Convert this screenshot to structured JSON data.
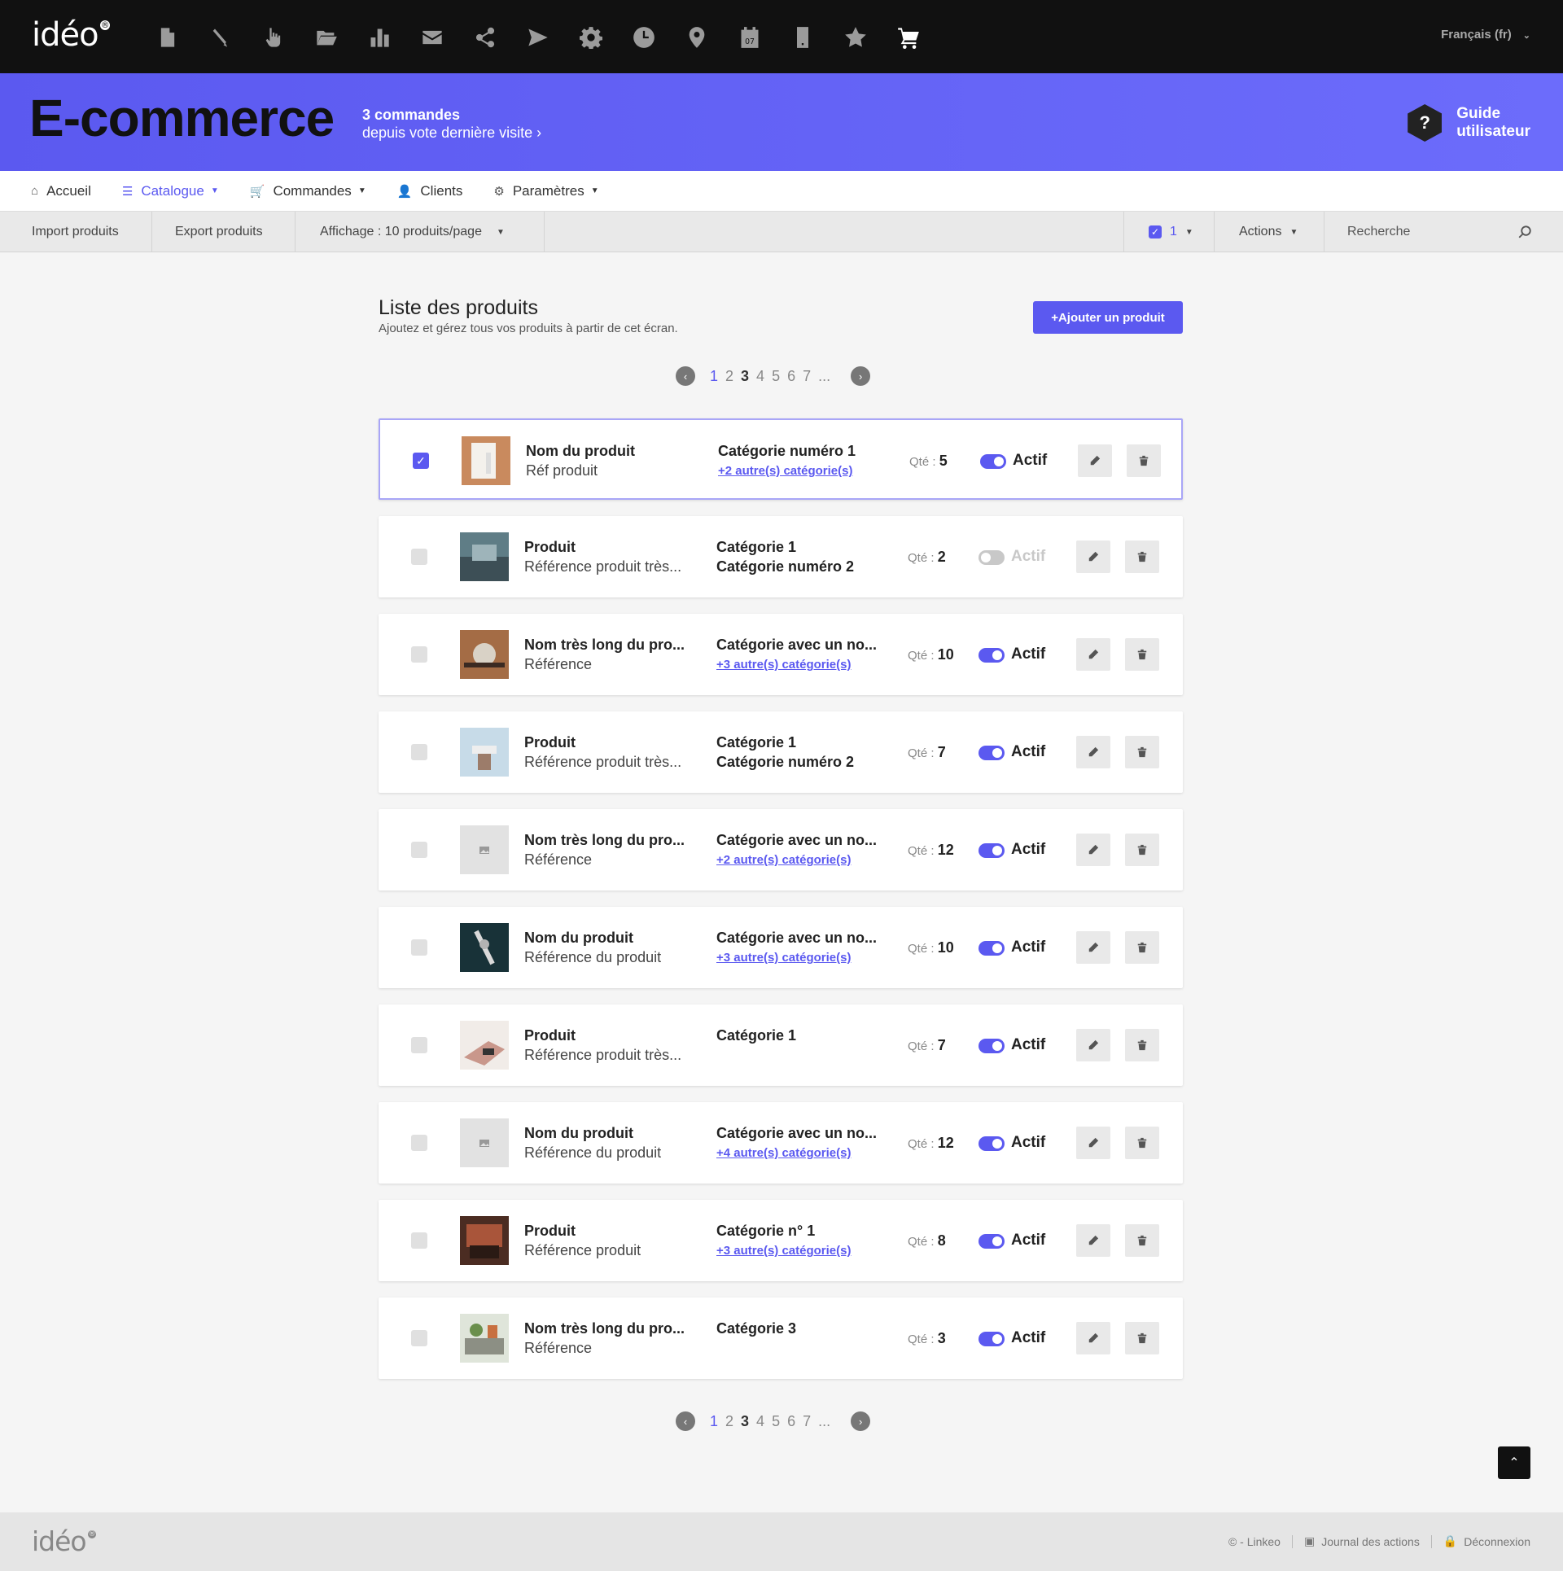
{
  "logo": "idéo",
  "topbar": {
    "icons": [
      "document-icon",
      "pencil-icon",
      "hand-pointer-icon",
      "folder-icon",
      "bar-chart-icon",
      "envelope-icon",
      "share-icon",
      "send-icon",
      "gear-icon",
      "clock-icon",
      "map-pin-icon",
      "calendar-icon",
      "mobile-icon",
      "star-icon",
      "cart-icon"
    ],
    "calendar_day": "07",
    "language": "Français (fr)"
  },
  "banner": {
    "title": "E-commerce",
    "orders_count": "3 commandes",
    "orders_since": "depuis vote dernière visite",
    "guide_icon": "?",
    "guide_line1": "Guide",
    "guide_line2": "utilisateur"
  },
  "nav": {
    "home": "Accueil",
    "catalogue": "Catalogue",
    "orders": "Commandes",
    "clients": "Clients",
    "settings": "Paramètres"
  },
  "toolbar": {
    "import": "Import produits",
    "export": "Export produits",
    "display": "Affichage : 10 produits/page",
    "selected_count": "1",
    "actions": "Actions",
    "search_placeholder": "Recherche"
  },
  "list": {
    "title": "Liste des produits",
    "subtitle": "Ajoutez et gérez tous vos produits à partir de cet écran.",
    "add_button": "+Ajouter un produit",
    "qty_label": "Qté :"
  },
  "pagination": {
    "pages": [
      "1",
      "2",
      "3",
      "4",
      "5",
      "6",
      "7",
      "..."
    ],
    "current": "1"
  },
  "products": [
    {
      "name": "Nom du produit",
      "ref": "Réf produit",
      "cat1": "Catégorie numéro 1",
      "cat2": "",
      "more": "+2 autre(s) catégorie(s)",
      "qty": "5",
      "status": "Actif",
      "active": true,
      "selected": true
    },
    {
      "name": "Produit",
      "ref": "Référence produit très...",
      "cat1": "Catégorie 1",
      "cat2": "Catégorie numéro 2",
      "more": "",
      "qty": "2",
      "status": "Actif",
      "active": false,
      "selected": false
    },
    {
      "name": "Nom très long du pro...",
      "ref": "Référence",
      "cat1": "Catégorie avec un no...",
      "cat2": "",
      "more": "+3 autre(s) catégorie(s)",
      "qty": "10",
      "status": "Actif",
      "active": true,
      "selected": false
    },
    {
      "name": "Produit",
      "ref": "Référence produit très...",
      "cat1": "Catégorie 1",
      "cat2": "Catégorie numéro 2",
      "more": "",
      "qty": "7",
      "status": "Actif",
      "active": true,
      "selected": false
    },
    {
      "name": "Nom très long du pro...",
      "ref": "Référence",
      "cat1": "Catégorie avec un no...",
      "cat2": "",
      "more": "+2 autre(s) catégorie(s)",
      "qty": "12",
      "status": "Actif",
      "active": true,
      "selected": false
    },
    {
      "name": "Nom du produit",
      "ref": "Référence du produit",
      "cat1": "Catégorie avec un no...",
      "cat2": "",
      "more": "+3 autre(s) catégorie(s)",
      "qty": "10",
      "status": "Actif",
      "active": true,
      "selected": false
    },
    {
      "name": "Produit",
      "ref": "Référence produit très...",
      "cat1": "Catégorie 1",
      "cat2": "",
      "more": "",
      "qty": "7",
      "status": "Actif",
      "active": true,
      "selected": false
    },
    {
      "name": "Nom du produit",
      "ref": "Référence du produit",
      "cat1": "Catégorie avec un no...",
      "cat2": "",
      "more": "+4 autre(s) catégorie(s)",
      "qty": "12",
      "status": "Actif",
      "active": true,
      "selected": false
    },
    {
      "name": "Produit",
      "ref": "Référence produit",
      "cat1": "Catégorie n° 1",
      "cat2": "",
      "more": "+3 autre(s) catégorie(s)",
      "qty": "8",
      "status": "Actif",
      "active": true,
      "selected": false
    },
    {
      "name": "Nom très long du pro...",
      "ref": "Référence",
      "cat1": "Catégorie 3",
      "cat2": "",
      "more": "",
      "qty": "3",
      "status": "Actif",
      "active": true,
      "selected": false
    }
  ],
  "footer": {
    "logo": "idéo",
    "copyright": "© - Linkeo",
    "journal": "Journal des actions",
    "logout": "Déconnexion"
  },
  "colors": {
    "accent": "#5b59f0",
    "topbar": "#111111",
    "banner": "#6462f6"
  }
}
